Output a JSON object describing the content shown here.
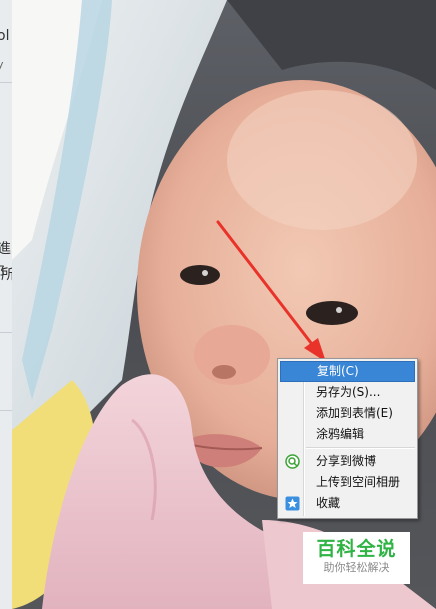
{
  "background_window": {
    "strip_chars": [
      "ol",
      "y",
      "進",
      "阝",
      "所"
    ]
  },
  "context_menu": {
    "items": [
      {
        "label": "复制(C)",
        "highlighted": true,
        "icon": null
      },
      {
        "label": "另存为(S)...",
        "highlighted": false,
        "icon": null
      },
      {
        "label": "添加到表情(E)",
        "highlighted": false,
        "icon": null
      },
      {
        "label": "涂鸦编辑",
        "highlighted": false,
        "icon": null
      },
      {
        "label": "分享到微博",
        "highlighted": false,
        "icon": "weibo-share-icon"
      },
      {
        "label": "上传到空间相册",
        "highlighted": false,
        "icon": null
      },
      {
        "label": "收藏",
        "highlighted": false,
        "icon": "favorite-star-icon"
      }
    ]
  },
  "watermark": {
    "title": "百科全说",
    "subtitle": "助你轻松解决",
    "color": "#2fb344"
  },
  "colors": {
    "menu_highlight": "#3a86d6",
    "arrow": "#e8322a"
  }
}
